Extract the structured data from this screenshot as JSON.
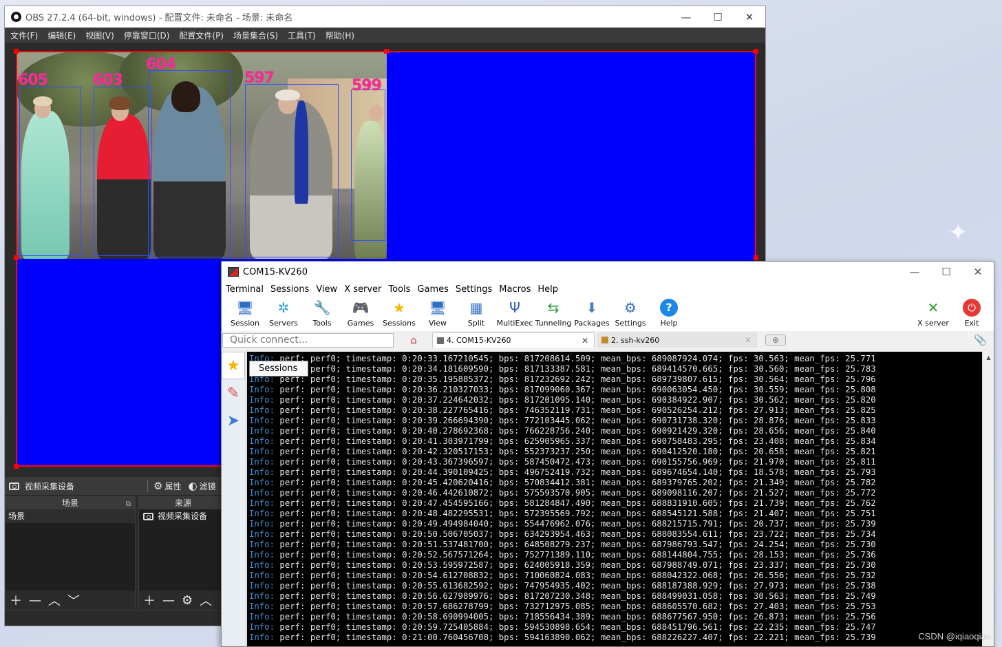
{
  "obs": {
    "title": "OBS 27.2.4 (64-bit, windows) - 配置文件: 未命名 - 场景: 未命名",
    "menu": [
      "文件(F)",
      "编辑(E)",
      "视图(V)",
      "停靠窗口(D)",
      "配置文件(P)",
      "场景集合(S)",
      "工具(T)",
      "帮助(H)"
    ],
    "detections": [
      "605",
      "603",
      "604",
      "597",
      "599"
    ],
    "source_toolbar": {
      "source_name": "视频采集设备",
      "properties": "属性",
      "filters": "滤镜"
    },
    "scenes_dock": {
      "header": "场景",
      "items": [
        "场景"
      ]
    },
    "sources_dock": {
      "header": "来源",
      "items": [
        "视频采集设备"
      ]
    }
  },
  "moba": {
    "title": "COM15-KV260",
    "menu": [
      "Terminal",
      "Sessions",
      "View",
      "X server",
      "Tools",
      "Games",
      "Settings",
      "Macros",
      "Help"
    ],
    "toolbar": [
      "Session",
      "Servers",
      "Tools",
      "Games",
      "Sessions",
      "View",
      "Split",
      "MultiExec",
      "Tunneling",
      "Packages",
      "Settings",
      "Help"
    ],
    "toolbar_right": [
      "X server",
      "Exit"
    ],
    "quick_connect_placeholder": "Quick connect...",
    "tabs": [
      "4. COM15-KV260",
      "2. ssh-kv260"
    ],
    "tooltip": "Sessions",
    "log_level": "Info:",
    "terminal_lines": [
      "perf0; timestamp: 0:20:33.167210545; bps: 817208614.509; mean_bps: 689087924.074; fps: 30.563; mean_fps: 25.771",
      "perf0; timestamp: 0:20:34.181609590; bps: 817133387.581; mean_bps: 689414570.665; fps: 30.560; mean_fps: 25.783",
      "perf0; timestamp: 0:20:35.195885372; bps: 817232692.242; mean_bps: 689739807.615; fps: 30.564; mean_fps: 25.796",
      "perf0; timestamp: 0:20:36.210327033; bps: 817099060.367; mean_bps: 690063054.450; fps: 30.559; mean_fps: 25.808",
      "perf0; timestamp: 0:20:37.224642032; bps: 817201095.140; mean_bps: 690384922.907; fps: 30.562; mean_fps: 25.820",
      "perf0; timestamp: 0:20:38.227765416; bps: 746352119.731; mean_bps: 690526254.212; fps: 27.913; mean_fps: 25.825",
      "perf0; timestamp: 0:20:39.266694390; bps: 772103445.062; mean_bps: 690731738.320; fps: 28.876; mean_fps: 25.833",
      "perf0; timestamp: 0:20:40.278692368; bps: 766228756.240; mean_bps: 690921429.320; fps: 28.656; mean_fps: 25.840",
      "perf0; timestamp: 0:20:41.303971799; bps: 625905965.337; mean_bps: 690758483.295; fps: 23.408; mean_fps: 25.834",
      "perf0; timestamp: 0:20:42.320517153; bps: 552373237.250; mean_bps: 690412520.180; fps: 20.658; mean_fps: 25.821",
      "perf0; timestamp: 0:20:43.367396597; bps: 587450472.473; mean_bps: 690155756.969; fps: 21.970; mean_fps: 25.811",
      "perf0; timestamp: 0:20:44.390109425; bps: 496752419.732; mean_bps: 689674654.140; fps: 18.578; mean_fps: 25.793",
      "perf0; timestamp: 0:20:45.420620416; bps: 570834412.381; mean_bps: 689379765.202; fps: 21.349; mean_fps: 25.782",
      "perf0; timestamp: 0:20:46.442610872; bps: 575593570.905; mean_bps: 689098116.207; fps: 21.527; mean_fps: 25.772",
      "perf0; timestamp: 0:20:47.454595166; bps: 581284847.490; mean_bps: 688831910.605; fps: 21.739; mean_fps: 25.762",
      "perf0; timestamp: 0:20:48.482295531; bps: 572395569.792; mean_bps: 688545121.588; fps: 21.407; mean_fps: 25.751",
      "perf0; timestamp: 0:20:49.494984040; bps: 554476962.076; mean_bps: 688215715.791; fps: 20.737; mean_fps: 25.739",
      "perf0; timestamp: 0:20:50.506705037; bps: 634293954.463; mean_bps: 688083554.611; fps: 23.722; mean_fps: 25.734",
      "perf0; timestamp: 0:20:51.537481700; bps: 648508279.237; mean_bps: 687986793.547; fps: 24.254; mean_fps: 25.730",
      "perf0; timestamp: 0:20:52.567571264; bps: 752771389.110; mean_bps: 688144804.755; fps: 28.153; mean_fps: 25.736",
      "perf0; timestamp: 0:20:53.595972587; bps: 624005918.359; mean_bps: 687988749.071; fps: 23.337; mean_fps: 25.730",
      "perf0; timestamp: 0:20:54.612708832; bps: 710060824.083; mean_bps: 688042322.068; fps: 26.556; mean_fps: 25.732",
      "perf0; timestamp: 0:20:55.613682592; bps: 747954935.402; mean_bps: 688187388.929; fps: 27.973; mean_fps: 25.738",
      "perf0; timestamp: 0:20:56.627989976; bps: 817207230.348; mean_bps: 688499031.058; fps: 30.563; mean_fps: 25.749",
      "perf0; timestamp: 0:20:57.686278799; bps: 732712975.085; mean_bps: 688605570.682; fps: 27.403; mean_fps: 25.753",
      "perf0; timestamp: 0:20:58.690994005; bps: 718556434.389; mean_bps: 688677567.950; fps: 26.873; mean_fps: 25.756",
      "perf0; timestamp: 0:20:59.725405884; bps: 594530898.654; mean_bps: 688451796.561; fps: 22.235; mean_fps: 25.747",
      "perf0; timestamp: 0:21:00.760456708; bps: 594163890.062; mean_bps: 688226227.407; fps: 22.221; mean_fps: 25.739"
    ]
  },
  "watermark": "CSDN @iqiaoqiao",
  "colors": {
    "canvas": "#0000ff",
    "selection": "#ff0000",
    "bbox": "#3050ff",
    "label": "#ff2a8a",
    "log_level": "#3d93d6"
  }
}
